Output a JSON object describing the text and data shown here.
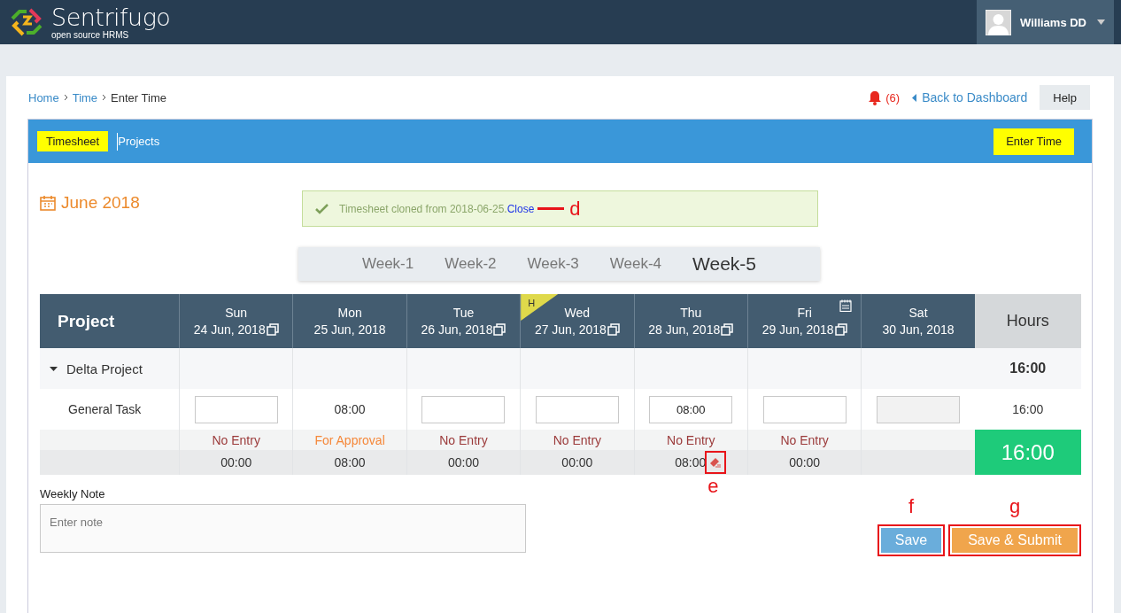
{
  "header": {
    "logo_title": "Sentrifugo",
    "logo_subtitle": "open source HRMS",
    "user_name": "Williams DD"
  },
  "breadcrumb": [
    {
      "label": "Home",
      "link": true
    },
    {
      "label": "Time",
      "link": true
    },
    {
      "label": "Enter Time",
      "link": false
    }
  ],
  "notifications": {
    "count": "(6)"
  },
  "back_link": "Back to Dashboard",
  "help_button": "Help",
  "nav_tabs": [
    {
      "label": "Timesheet",
      "selected": true
    },
    {
      "label": "Projects",
      "selected": false
    }
  ],
  "enter_time_button": "Enter Time",
  "month_title": "June 2018",
  "alert": {
    "message": "Timesheet cloned from 2018-06-25.",
    "close": "Close",
    "annotation": "d"
  },
  "weeks": [
    {
      "label": "Week-1",
      "selected": false
    },
    {
      "label": "Week-2",
      "selected": false
    },
    {
      "label": "Week-3",
      "selected": false
    },
    {
      "label": "Week-4",
      "selected": false
    },
    {
      "label": "Week-5",
      "selected": true
    }
  ],
  "table": {
    "project_header": "Project",
    "hours_header": "Hours",
    "days": [
      {
        "day": "Sun",
        "date": "24 Jun, 2018",
        "copy": true,
        "calendar": false
      },
      {
        "day": "Mon",
        "date": "25 Jun, 2018",
        "copy": false,
        "calendar": false
      },
      {
        "day": "Tue",
        "date": "26 Jun, 2018",
        "copy": true,
        "calendar": false
      },
      {
        "day": "Wed",
        "date": "27 Jun, 2018",
        "copy": true,
        "holiday": "H",
        "calendar": false
      },
      {
        "day": "Thu",
        "date": "28 Jun, 2018",
        "copy": true,
        "calendar": false
      },
      {
        "day": "Fri",
        "date": "29 Jun, 2018",
        "copy": true,
        "calendar": true
      },
      {
        "day": "Sat",
        "date": "30 Jun, 2018",
        "copy": false,
        "calendar": false
      }
    ],
    "project": {
      "name": "Delta Project",
      "expanded": true,
      "total": "16:00"
    },
    "task": {
      "name": "General Task",
      "total": "16:00",
      "entries": [
        {
          "kind": "input"
        },
        {
          "kind": "text",
          "value": "08:00"
        },
        {
          "kind": "input"
        },
        {
          "kind": "input"
        },
        {
          "kind": "input",
          "value": "08:00"
        },
        {
          "kind": "input"
        },
        {
          "kind": "disabled"
        }
      ]
    },
    "statuses": [
      {
        "kind": "no_entry",
        "label": "No Entry"
      },
      {
        "kind": "for_approval",
        "label": "For Approval"
      },
      {
        "kind": "no_entry",
        "label": "No Entry"
      },
      {
        "kind": "no_entry",
        "label": "No Entry"
      },
      {
        "kind": "no_entry",
        "label": "No Entry"
      },
      {
        "kind": "no_entry",
        "label": "No Entry"
      },
      {
        "kind": "none"
      }
    ],
    "day_totals": [
      {
        "value": "00:00",
        "eraser": false
      },
      {
        "value": "08:00",
        "eraser": false
      },
      {
        "value": "00:00",
        "eraser": false
      },
      {
        "value": "00:00",
        "eraser": false
      },
      {
        "value": "08:00",
        "eraser": true,
        "annotation": "e"
      },
      {
        "value": "00:00",
        "eraser": false
      },
      {
        "eraser": false
      }
    ],
    "grand_total": "16:00"
  },
  "weekly_note": {
    "label": "Weekly Note",
    "placeholder": "Enter note"
  },
  "buttons": [
    {
      "kind": "save",
      "label": "Save",
      "annotation": "f"
    },
    {
      "kind": "submit",
      "label": "Save & Submit",
      "annotation": "g"
    }
  ]
}
